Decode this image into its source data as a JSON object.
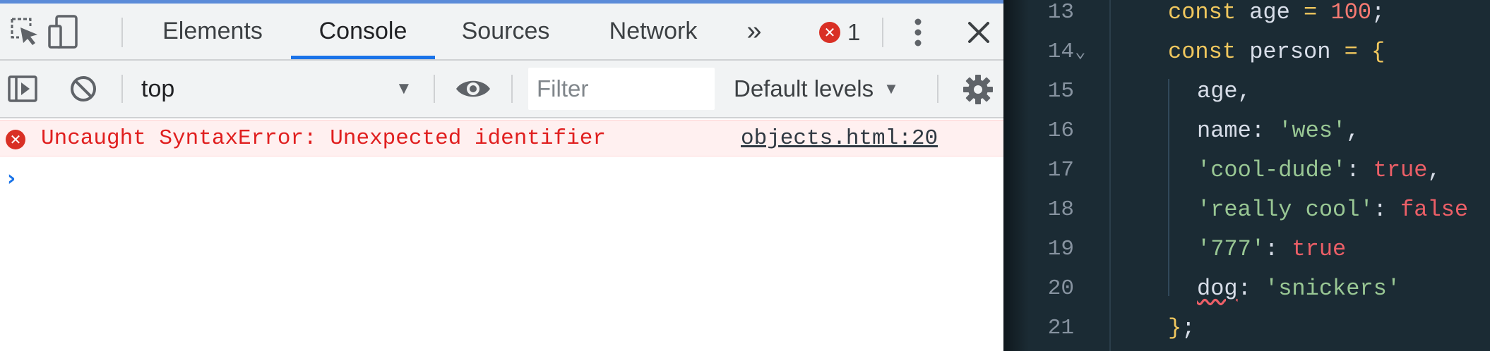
{
  "devtools": {
    "tabs": [
      {
        "label": "Elements"
      },
      {
        "label": "Console"
      },
      {
        "label": "Sources"
      },
      {
        "label": "Network"
      }
    ],
    "active_tab": "Console",
    "more_tabs_label": "»",
    "error_count": "1",
    "toolbar": {
      "context": "top",
      "filter_placeholder": "Filter",
      "levels_label": "Default levels"
    },
    "console": {
      "error_message": "Uncaught SyntaxError: Unexpected identifier",
      "error_source": "objects.html:20",
      "prompt_symbol": "›"
    }
  },
  "editor": {
    "lines": [
      {
        "number": "13",
        "folded": "",
        "tokens": [
          {
            "t": "const",
            "c": "kw"
          },
          {
            "t": " age ",
            "c": "id"
          },
          {
            "t": "=",
            "c": "op"
          },
          {
            "t": " ",
            "c": "id"
          },
          {
            "t": "100",
            "c": "num"
          },
          {
            "t": ";",
            "c": "punc"
          }
        ]
      },
      {
        "number": "14",
        "folded": "⌄",
        "tokens": [
          {
            "t": "const",
            "c": "kw"
          },
          {
            "t": " person ",
            "c": "id"
          },
          {
            "t": "=",
            "c": "op"
          },
          {
            "t": " ",
            "c": "id"
          },
          {
            "t": "{",
            "c": "kw"
          }
        ]
      },
      {
        "number": "15",
        "folded": "",
        "tokens": [
          {
            "t": "age,",
            "c": "id"
          }
        ]
      },
      {
        "number": "16",
        "folded": "",
        "tokens": [
          {
            "t": "name",
            "c": "id"
          },
          {
            "t": ": ",
            "c": "punc"
          },
          {
            "t": "'wes'",
            "c": "str"
          },
          {
            "t": ",",
            "c": "punc"
          }
        ]
      },
      {
        "number": "17",
        "folded": "",
        "tokens": [
          {
            "t": "'cool-dude'",
            "c": "str"
          },
          {
            "t": ": ",
            "c": "punc"
          },
          {
            "t": "true",
            "c": "bool"
          },
          {
            "t": ",",
            "c": "punc"
          }
        ]
      },
      {
        "number": "18",
        "folded": "",
        "tokens": [
          {
            "t": "'really cool'",
            "c": "str"
          },
          {
            "t": ": ",
            "c": "punc"
          },
          {
            "t": "false",
            "c": "bool"
          }
        ]
      },
      {
        "number": "19",
        "folded": "",
        "tokens": [
          {
            "t": "'777'",
            "c": "str"
          },
          {
            "t": ": ",
            "c": "punc"
          },
          {
            "t": "true",
            "c": "bool"
          }
        ]
      },
      {
        "number": "20",
        "folded": "",
        "tokens": [
          {
            "t": "dog",
            "c": "id squiggle"
          },
          {
            "t": ": ",
            "c": "punc"
          },
          {
            "t": "'snickers'",
            "c": "str"
          }
        ]
      },
      {
        "number": "21",
        "folded": "",
        "tokens": [
          {
            "t": "}",
            "c": "kw"
          },
          {
            "t": ";",
            "c": "punc"
          }
        ]
      }
    ]
  },
  "colors": {
    "editor_bg": "#1b2b34",
    "error_text": "#e01f1f",
    "error_row_bg": "#fff0f0",
    "active_tab_underline": "#1a73e8"
  }
}
